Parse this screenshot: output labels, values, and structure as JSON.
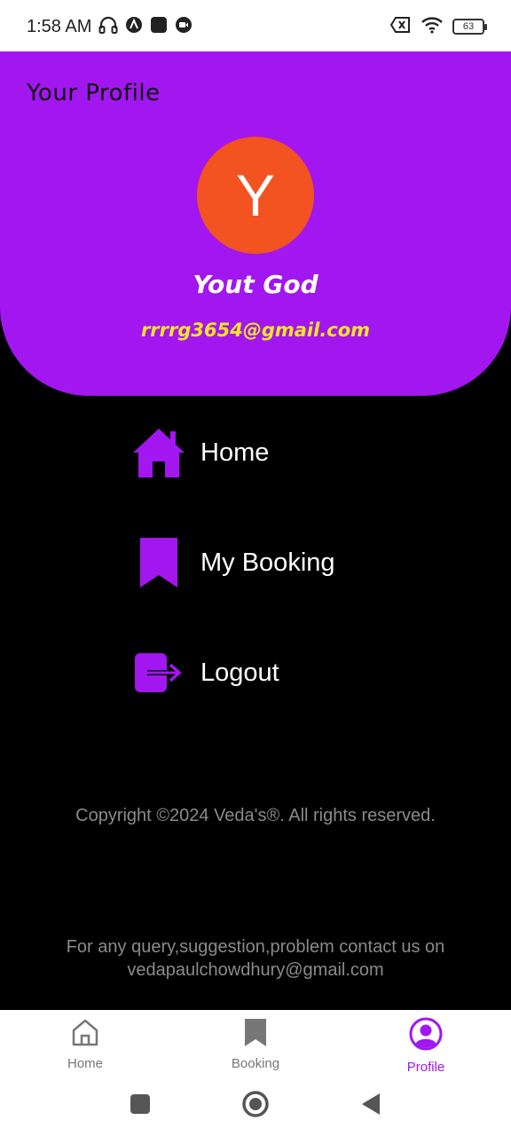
{
  "status_bar": {
    "time": "1:58 AM",
    "battery": "63"
  },
  "header": {
    "title": "Your Profile",
    "avatar_letter": "Y",
    "avatar_color": "#f35221",
    "user_name": "Yout God",
    "user_email": "rrrrg3654@gmail.com",
    "background": "#a216ef"
  },
  "menu": {
    "items": [
      {
        "label": "Home",
        "icon": "home-icon"
      },
      {
        "label": "My Booking",
        "icon": "bookmark-icon"
      },
      {
        "label": "Logout",
        "icon": "logout-icon"
      }
    ]
  },
  "footer": {
    "copyright": "Copyright ©2024 Veda's®. All rights reserved.",
    "contact_line1": "For any query,suggestion,problem contact us on",
    "contact_line2": "vedapaulchowdhury@gmail.com"
  },
  "bottom_nav": {
    "tabs": [
      {
        "label": "Home",
        "icon": "home-outline-icon",
        "active": false
      },
      {
        "label": "Booking",
        "icon": "bookmark-icon",
        "active": false
      },
      {
        "label": "Profile",
        "icon": "profile-icon",
        "active": true
      }
    ]
  },
  "colors": {
    "accent": "#a216ef",
    "email": "#f6e623",
    "footer_text": "#8a8a8a"
  }
}
